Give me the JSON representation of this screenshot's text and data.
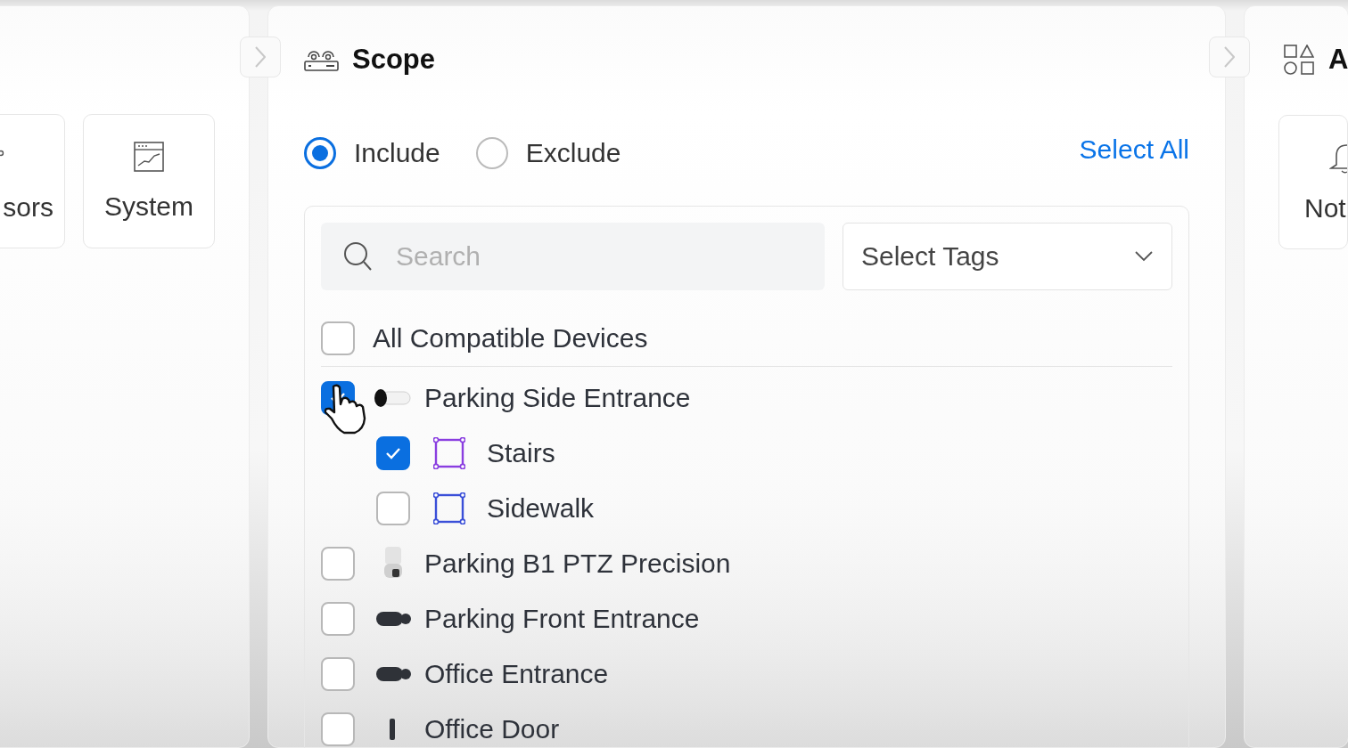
{
  "left_panel": {
    "cards": [
      {
        "label": "sors",
        "kind": "sensors"
      },
      {
        "label": "System",
        "kind": "system"
      }
    ]
  },
  "scope": {
    "title": "Scope",
    "modes": [
      {
        "label": "Include",
        "selected": true
      },
      {
        "label": "Exclude",
        "selected": false
      }
    ],
    "select_all": "Select All",
    "search": {
      "placeholder": "Search"
    },
    "tags": {
      "label": "Select Tags"
    },
    "all_devices": {
      "label": "All Compatible Devices",
      "checked": false
    },
    "devices": [
      {
        "name": "Parking Side Entrance",
        "kind": "bullet_white",
        "checked": true,
        "children": [
          {
            "name": "Stairs",
            "checked": true,
            "color": "#8a3ee0"
          },
          {
            "name": "Sidewalk",
            "checked": false,
            "color": "#3a4fd8"
          }
        ]
      },
      {
        "name": "Parking B1 PTZ Precision",
        "kind": "ptz",
        "checked": false
      },
      {
        "name": "Parking Front Entrance",
        "kind": "bullet_dark",
        "checked": false
      },
      {
        "name": "Office Entrance",
        "kind": "bullet_dark",
        "checked": false
      },
      {
        "name": "Office Door",
        "kind": "door",
        "checked": false
      }
    ]
  },
  "right_panel": {
    "title": "A",
    "cards": [
      {
        "label": "Not",
        "kind": "notifications"
      }
    ]
  }
}
